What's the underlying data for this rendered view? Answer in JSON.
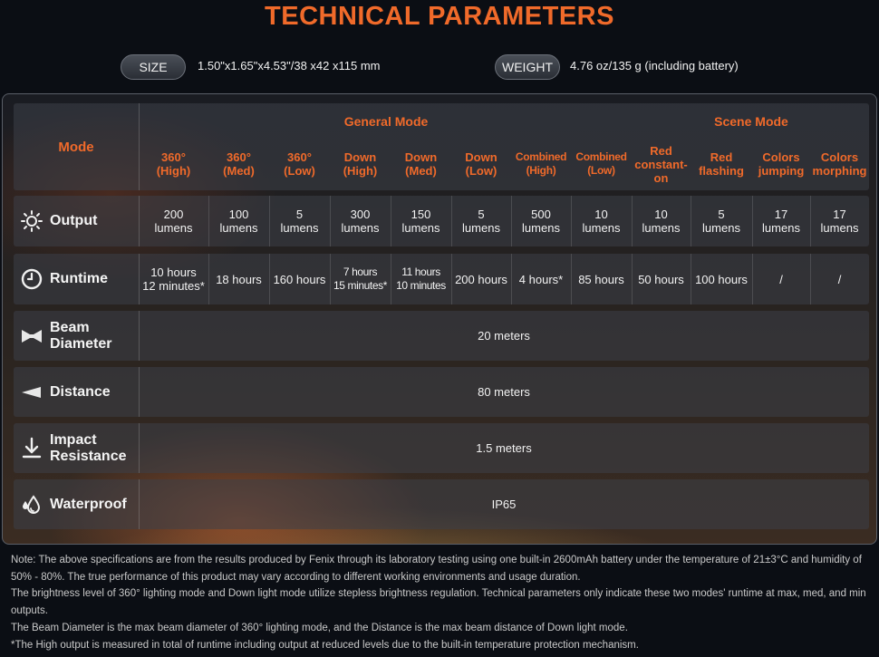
{
  "title": "TECHNICAL PARAMETERS",
  "specs": {
    "size_label": "SIZE",
    "size_value": "1.50\"x1.65\"x4.53\"/38 x42 x115 mm",
    "weight_label": "WEIGHT",
    "weight_value": "4.76 oz/135 g (including battery)"
  },
  "table": {
    "mode_label": "Mode",
    "groups": [
      "General Mode",
      "Scene Mode"
    ],
    "modes": [
      "360°\n(High)",
      "360°\n(Med)",
      "360°\n(Low)",
      "Down\n(High)",
      "Down\n(Med)",
      "Down\n(Low)",
      "Combined\n(High)",
      "Combined\n(Low)",
      "Red\nconstant-\non",
      "Red\nflashing",
      "Colors\njumping",
      "Colors\nmorphing"
    ],
    "rows": {
      "output": {
        "label": "Output",
        "icon": "sun-icon",
        "values": [
          "200\nlumens",
          "100\nlumens",
          "5\nlumens",
          "300\nlumens",
          "150\nlumens",
          "5\nlumens",
          "500\nlumens",
          "10\nlumens",
          "10\nlumens",
          "5\nlumens",
          "17\nlumens",
          "17\nlumens"
        ]
      },
      "runtime": {
        "label": "Runtime",
        "icon": "clock-icon",
        "values": [
          "10 hours\n12 minutes*",
          "18 hours",
          "160 hours",
          "7 hours\n15 minutes*",
          "11 hours\n10 minutes",
          "200 hours",
          "4 hours*",
          "85 hours",
          "50 hours",
          "100 hours",
          "/",
          "/"
        ]
      },
      "beam": {
        "label": "Beam\nDiameter",
        "icon": "beam-icon",
        "value": "20 meters"
      },
      "distance": {
        "label": "Distance",
        "icon": "distance-icon",
        "value": "80 meters"
      },
      "impact": {
        "label": "Impact\nResistance",
        "icon": "drop-arrow-icon",
        "value": "1.5 meters"
      },
      "waterproof": {
        "label": "Waterproof",
        "icon": "water-drops-icon",
        "value": "IP65"
      }
    }
  },
  "notes": [
    "Note: The above specifications are from the results produced by Fenix through its laboratory testing using one built-in 2600mAh battery under the temperature of 21±3°C and humidity of 50% - 80%. The true performance of this product may vary according to different working environments and usage duration.",
    "The brightness level of 360° lighting mode and Down light mode utilize stepless brightness regulation. Technical parameters only indicate these two modes' runtime at max, med, and min outputs.",
    "The Beam Diameter is the max beam diameter of 360° lighting mode, and the Distance is the max beam distance of Down light mode.",
    "*The High output is measured in total of runtime including output at reduced levels due to the built-in temperature protection mechanism."
  ],
  "colors": {
    "accent": "#f06a2a",
    "background": "#0b0e14"
  }
}
